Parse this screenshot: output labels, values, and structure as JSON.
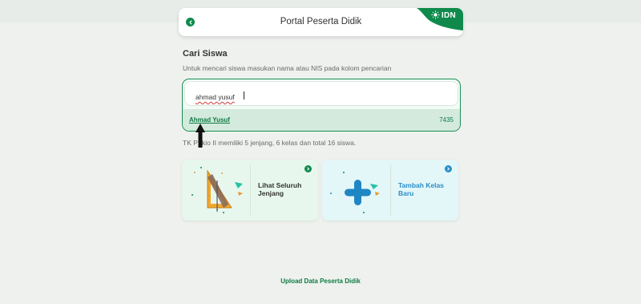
{
  "header": {
    "title": "Portal Peserta Didik",
    "logo_text": "IDN",
    "brand_color": "#0f8a4c"
  },
  "search": {
    "title": "Cari Siswa",
    "subtitle": "Untuk mencari siswa masukan nama atau NIS pada kolom pencarian",
    "value": "ahmad yusuf",
    "results": [
      {
        "name": "Ahmad Yusuf",
        "nis": "7435"
      }
    ]
  },
  "info": {
    "text": "TK P   kio II memiliki 5 jenjang, 6 kelas dan total 16 siswa."
  },
  "cards": [
    {
      "label": "Lihat Seluruh Jenjang",
      "icon": "ruler-triangle-icon"
    },
    {
      "label": "Tambah Kelas Baru",
      "icon": "plus-icon"
    }
  ],
  "footer": {
    "upload_label": "Upload Data Peserta Didik"
  }
}
